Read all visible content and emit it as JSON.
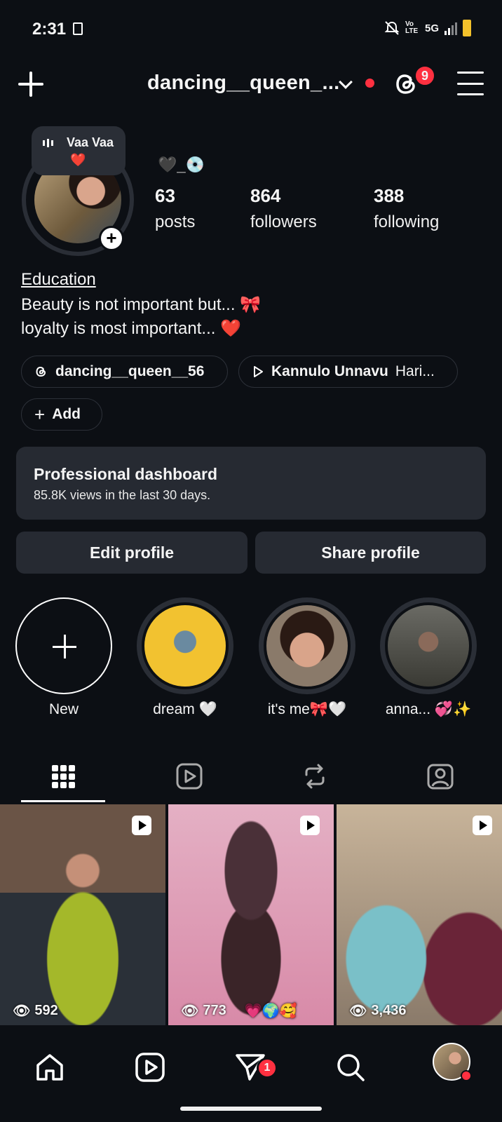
{
  "status_bar": {
    "time": "2:31",
    "network": "5G",
    "volte": "Vo LTE",
    "icons": [
      "sim-card-icon",
      "mute-icon",
      "signal-icon",
      "battery-icon"
    ]
  },
  "header": {
    "username": "dancing__queen_...",
    "threads_badge_count": "9",
    "icons": [
      "plus-icon",
      "chevron-down-icon",
      "threads-icon",
      "menu-icon"
    ]
  },
  "note": {
    "text": "Vaa Vaa",
    "emoji": "❤️"
  },
  "profile": {
    "bio_emoji": "🖤_💿",
    "stats": [
      {
        "value": "63",
        "label": "posts"
      },
      {
        "value": "864",
        "label": "followers"
      },
      {
        "value": "388",
        "label": "following"
      }
    ],
    "category": "Education",
    "bio_lines": [
      "Beauty is not important but... 🎀",
      "loyalty is most important... ❤️"
    ]
  },
  "chips": {
    "threads_handle": "dancing__queen__56",
    "song_title": "Kannulo Unnavu",
    "song_artist": "Hari...",
    "add_label": "Add"
  },
  "dashboard": {
    "title": "Professional dashboard",
    "subtitle": "85.8K views in the last 30 days."
  },
  "actions": {
    "edit_label": "Edit profile",
    "share_label": "Share profile"
  },
  "highlights": [
    {
      "label": "New"
    },
    {
      "label": "dream 🤍"
    },
    {
      "label": "it's me🎀🤍"
    },
    {
      "label": "anna... 💞✨"
    }
  ],
  "tabs": [
    "grid-icon",
    "reels-icon",
    "reposts-icon",
    "tagged-icon"
  ],
  "posts": [
    {
      "views": "592"
    },
    {
      "views": "773"
    },
    {
      "views": "3,436"
    }
  ],
  "post_overlay_text": "💗🌍🥰",
  "bottom_nav": {
    "messages_badge": "1",
    "icons": [
      "home-icon",
      "reels-nav-icon",
      "messages-icon",
      "search-icon",
      "profile-avatar"
    ]
  },
  "colors": {
    "background": "#0c0f14",
    "surface": "#262a32",
    "accent_red": "#ff3040"
  }
}
